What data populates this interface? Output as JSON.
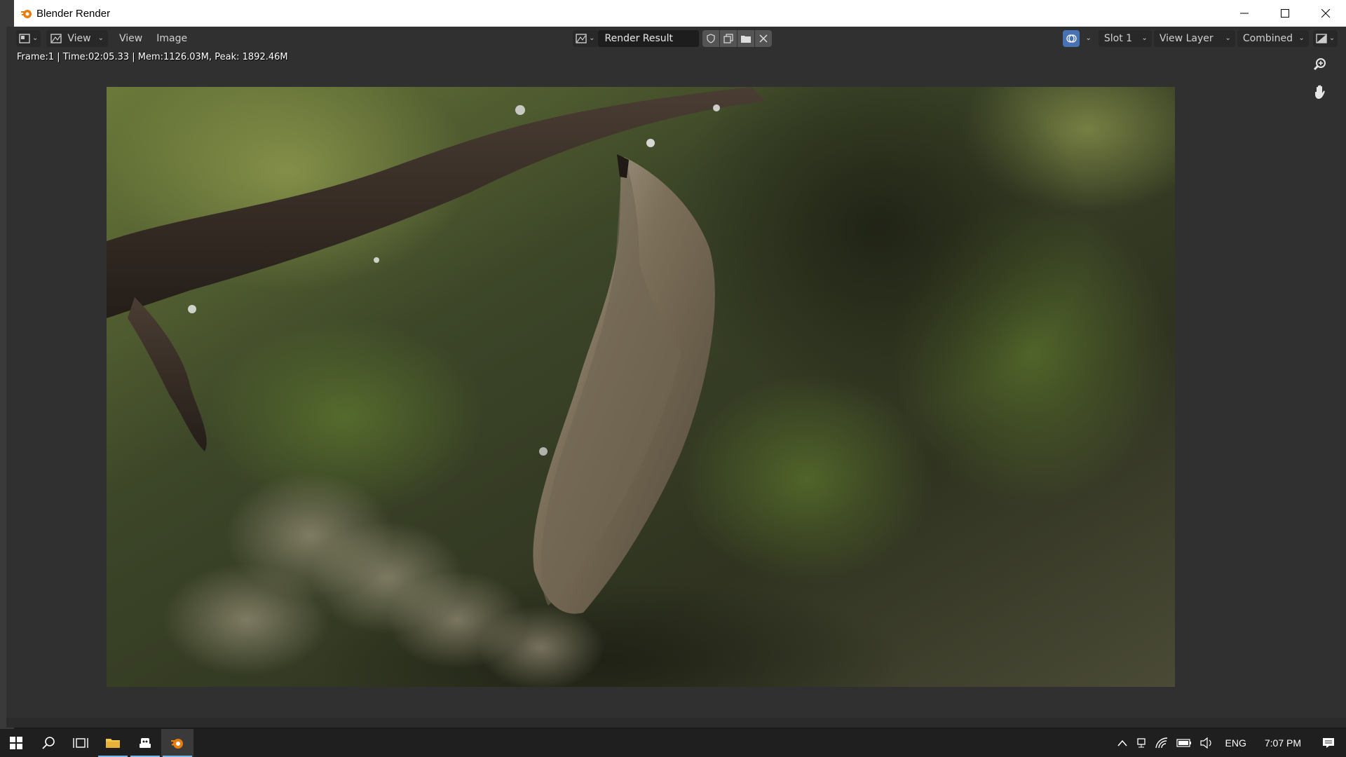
{
  "window": {
    "title": "Blender Render"
  },
  "header": {
    "view_dropdown_label": "View",
    "menus": [
      "View",
      "Image"
    ],
    "image_name": "Render Result",
    "slot": "Slot 1",
    "view_layer": "View Layer",
    "pass": "Combined"
  },
  "stats": {
    "text": "Frame:1 | Time:02:05.33 | Mem:1126.03M, Peak: 1892.46M"
  },
  "taskbar": {
    "language": "ENG",
    "time": "7:07 PM"
  },
  "colors": {
    "blender_bg": "#303030",
    "header_field": "#1d1d1d",
    "taskbar_accent": "#76b9ed"
  },
  "icons": [
    "blender-logo-icon",
    "minimize-icon",
    "maximize-icon",
    "close-icon",
    "editor-type-icon",
    "image-icon",
    "shield-icon",
    "duplicate-icon",
    "folder-icon",
    "x-icon",
    "overlay-icon",
    "display-channels-icon",
    "zoom-icon",
    "hand-icon",
    "windows-start-icon",
    "search-icon",
    "task-view-icon",
    "file-explorer-icon",
    "app-icon",
    "blender-taskbar-icon",
    "chevron-up-icon",
    "network-icon",
    "wifi-icon",
    "battery-icon",
    "volume-icon",
    "notification-icon"
  ]
}
